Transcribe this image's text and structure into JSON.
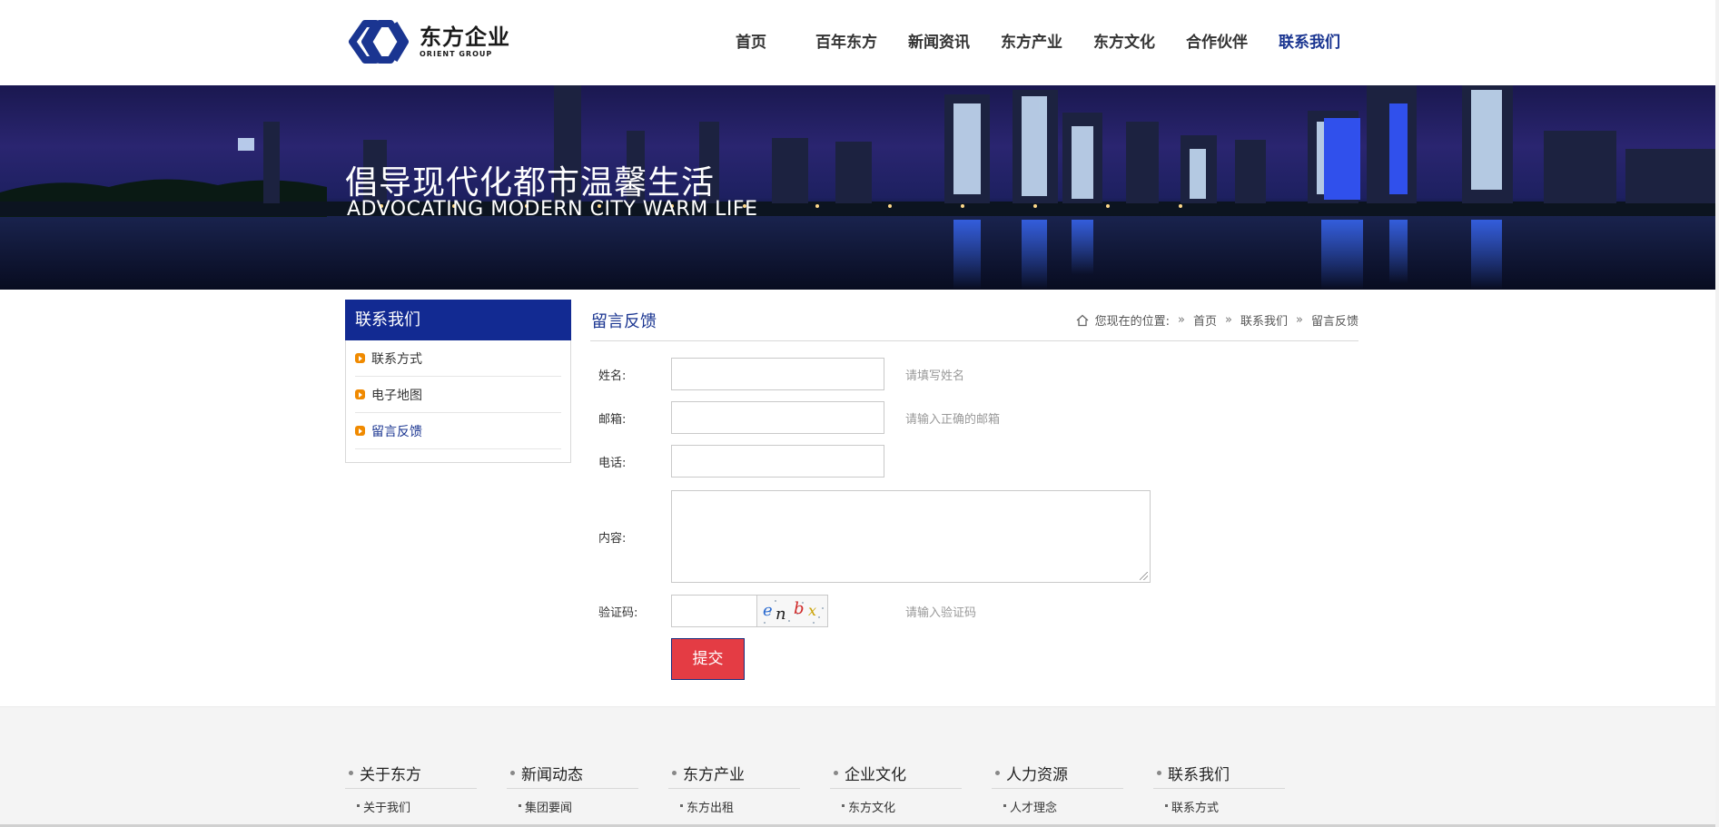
{
  "header": {
    "logo_cn": "东方企业",
    "logo_en": "ORIENT GROUP",
    "nav": [
      "首页",
      "百年东方",
      "新闻资讯",
      "东方产业",
      "东方文化",
      "合作伙伴",
      "联系我们"
    ],
    "nav_active": "联系我们"
  },
  "banner": {
    "title": "倡导现代化都市温馨生活",
    "subtitle": "ADVOCATING MODERN CITY WARM LIFE"
  },
  "sidebar": {
    "title": "联系我们",
    "items": [
      "联系方式",
      "电子地图",
      "留言反馈"
    ],
    "current": "留言反馈"
  },
  "content": {
    "title": "留言反馈",
    "breadcrumb": {
      "prefix": "您现在的位置:",
      "sep": "»",
      "items": [
        "首页",
        "联系我们",
        "留言反馈"
      ]
    }
  },
  "form": {
    "name_label": "姓名:",
    "name_hint": "请填写姓名",
    "email_label": "邮箱:",
    "email_hint": "请输入正确的邮箱",
    "phone_label": "电话:",
    "content_label": "内容:",
    "captcha_label": "验证码:",
    "captcha_text": "enbx",
    "captcha_hint": "请输入验证码",
    "submit": "提交"
  },
  "footer": {
    "columns": [
      {
        "title": "关于东方",
        "link": "关于我们"
      },
      {
        "title": "新闻动态",
        "link": "集团要闻"
      },
      {
        "title": "东方产业",
        "link": "东方出租"
      },
      {
        "title": "企业文化",
        "link": "东方文化"
      },
      {
        "title": "人力资源",
        "link": "人才理念"
      },
      {
        "title": "联系我们",
        "link": "联系方式"
      }
    ]
  },
  "colors": {
    "brand_blue": "#122a92",
    "accent_red": "#e43c44",
    "bullet_orange": "#f08a00"
  }
}
